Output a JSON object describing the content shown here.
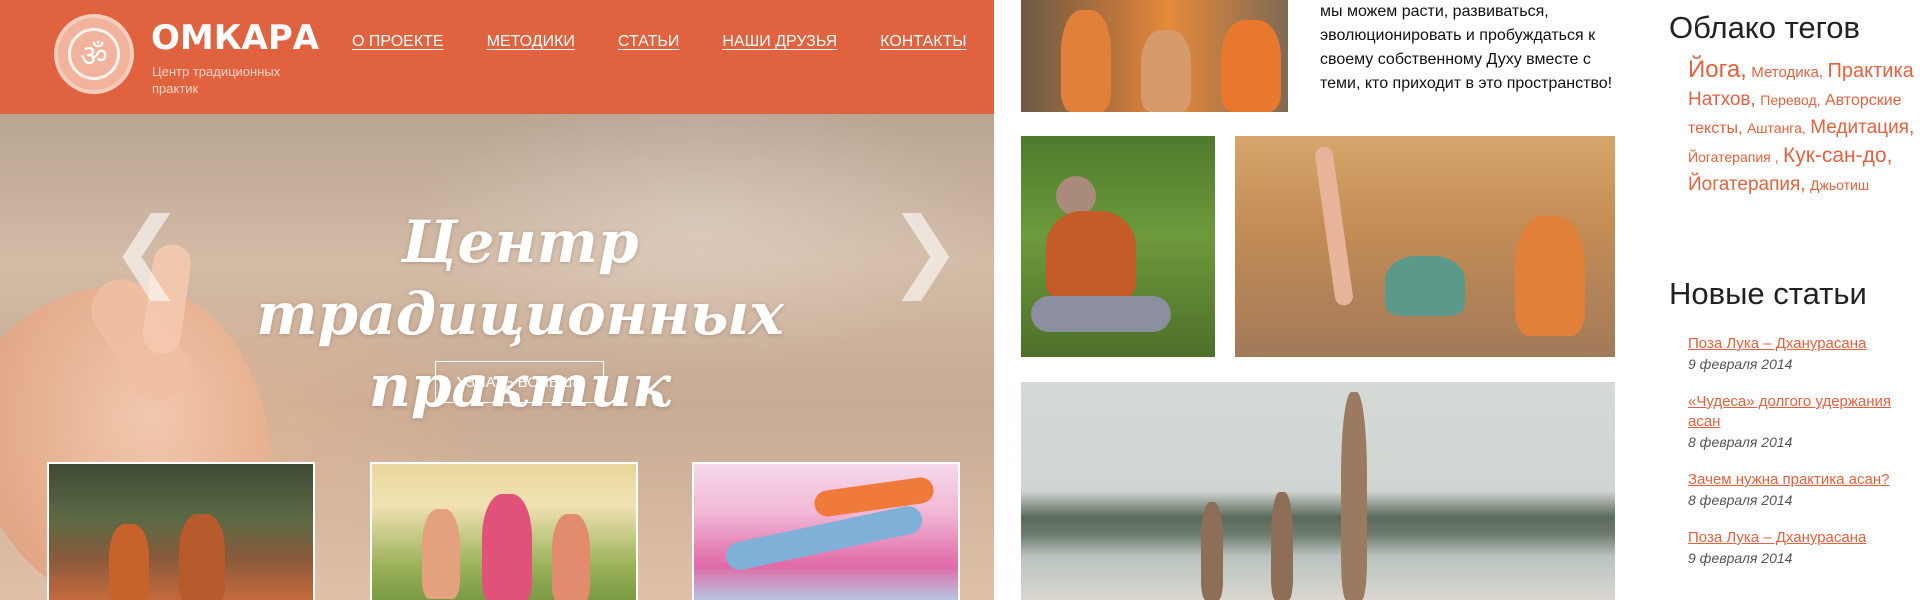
{
  "header": {
    "brand": "ОМКАРА",
    "tagline": "Центр традиционных практик",
    "logo_symbol": "ॐ",
    "nav": [
      {
        "label": "О ПРОЕКТЕ"
      },
      {
        "label": "МЕТОДИКИ"
      },
      {
        "label": "СТАТЬИ"
      },
      {
        "label": "НАШИ ДРУЗЬЯ"
      },
      {
        "label": "КОНТАКТЫ"
      }
    ]
  },
  "hero": {
    "title": "Центр традиционных практик",
    "button": "УЗНАТЬ БОЛЬШЕ",
    "prev_icon": "❮",
    "next_icon": "❯"
  },
  "intro_text": "мы можем расти, развиваться, эволюционировать и пробуждаться к своему собственному Духу вместе с теми, кто приходит в это пространство!",
  "sidebar": {
    "tag_cloud_title": "Облако тегов",
    "tags": [
      {
        "label": "Йога,",
        "size": 24
      },
      {
        "label": "Методика,",
        "size": 15
      },
      {
        "label": "Практика",
        "size": 20
      },
      {
        "label": "Натхов,",
        "size": 19
      },
      {
        "label": "Перевод,",
        "size": 14
      },
      {
        "label": "Авторские тексты,",
        "size": 16
      },
      {
        "label": "Аштанга,",
        "size": 14
      },
      {
        "label": "Медитация,",
        "size": 19
      },
      {
        "label": "Йогатерапия ,",
        "size": 14
      },
      {
        "label": "Кук-сан-до,",
        "size": 21
      },
      {
        "label": "Йогатерапия,",
        "size": 19
      },
      {
        "label": "Джьотиш",
        "size": 14
      }
    ],
    "new_posts_title": "Новые статьи",
    "posts": [
      {
        "title": "Поза Лука – Дханурасана",
        "date": "9 февраля 2014"
      },
      {
        "title": "«Чудеса» долгого удержания асан",
        "date": "8 февраля 2014"
      },
      {
        "title": "Зачем нужна практика асан?",
        "date": "8 февраля 2014"
      },
      {
        "title": "Поза Лука – Дханурасана",
        "date": "9 февраля 2014"
      }
    ]
  },
  "colors": {
    "brand_orange": "#e0623f",
    "tagline": "#fbd3c4"
  }
}
